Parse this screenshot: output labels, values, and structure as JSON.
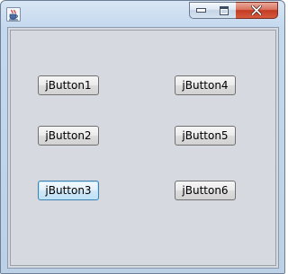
{
  "window": {
    "controls": {
      "minimize": "minimize",
      "maximize": "maximize",
      "close": "close"
    }
  },
  "buttons": [
    {
      "label": "jButton1"
    },
    {
      "label": "jButton2"
    },
    {
      "label": "jButton3",
      "focused": true
    },
    {
      "label": "jButton4"
    },
    {
      "label": "jButton5"
    },
    {
      "label": "jButton6"
    }
  ],
  "colors": {
    "client_background": "#d6d9df",
    "close_button": "#c53a22",
    "focus_border": "#3c7fb1"
  }
}
